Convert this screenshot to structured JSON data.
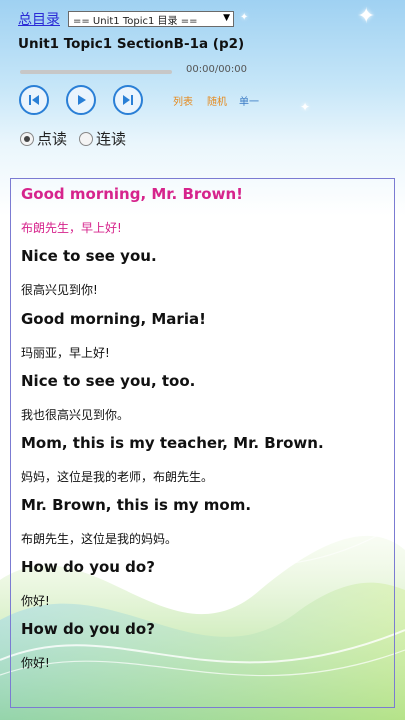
{
  "nav": {
    "toc_label": "总目录",
    "unit_select": "== Unit1 Topic1 目录 =="
  },
  "title": "Unit1 Topic1 SectionB-1a  (p2)",
  "player": {
    "time": "00:00/00:00",
    "progress": 0.0
  },
  "modes": {
    "list": "列表",
    "random": "随机",
    "single": "单一"
  },
  "read_modes": [
    {
      "label": "点读",
      "checked": true
    },
    {
      "label": "连读",
      "checked": false
    }
  ],
  "lines": [
    {
      "en": "Good morning, Mr. Brown!",
      "zh": "布朗先生，早上好!"
    },
    {
      "en": "Nice to see you.",
      "zh": "很高兴见到你!"
    },
    {
      "en": "Good morning, Maria!",
      "zh": "玛丽亚，早上好!"
    },
    {
      "en": "Nice to see you, too.",
      "zh": "我也很高兴见到你。"
    },
    {
      "en": "Mom, this is my teacher, Mr. Brown.",
      "zh": "妈妈，这位是我的老师，布朗先生。"
    },
    {
      "en": "Mr. Brown, this is my mom.",
      "zh": "布朗先生，这位是我的妈妈。"
    },
    {
      "en": "How do you do?",
      "zh": "你好!"
    },
    {
      "en": "How do you do?",
      "zh": "你好!"
    }
  ],
  "colors": {
    "active": "#d6248c",
    "accent": "#2a7fd6",
    "mode_orange": "#e58a1e"
  },
  "icons": {
    "prev": "skip-previous-icon",
    "play": "play-icon",
    "next": "skip-next-icon"
  }
}
